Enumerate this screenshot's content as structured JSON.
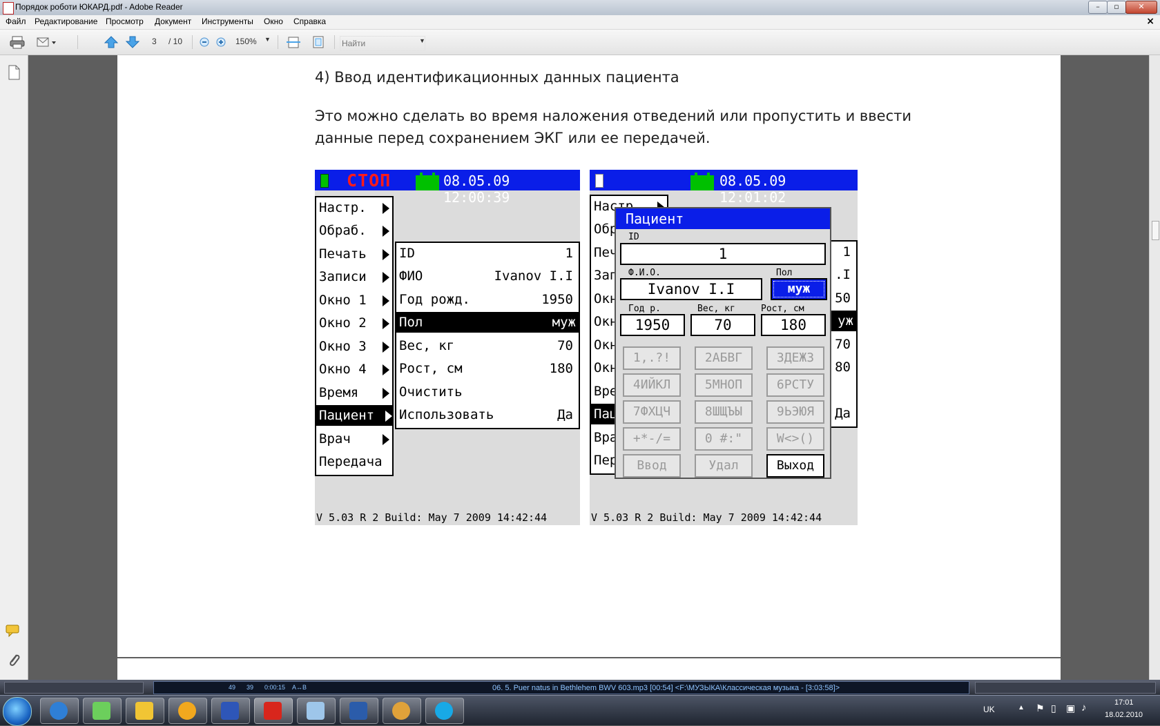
{
  "window": {
    "title": "Порядок роботи ЮКАРД.pdf - Adobe Reader"
  },
  "menu": [
    "Файл",
    "Редактирование",
    "Просмотр",
    "Документ",
    "Инструменты",
    "Окно",
    "Справка"
  ],
  "toolbar": {
    "page_current": "3",
    "page_total": "/ 10",
    "zoom": "150%",
    "find_placeholder": "Найти"
  },
  "doc": {
    "heading": "4)   Ввод идентификационных данных пациента",
    "para1": "Это можно сделать во время наложения отведений или пропустить и ввести",
    "para2": "данные перед сохранением ЭКГ или ее передачей."
  },
  "screen1": {
    "status": "СТОП",
    "datetime": "08.05.09  12:00:39",
    "menu": [
      "Настр.",
      "Обраб.",
      "Печать",
      "Записи",
      "Окно 1",
      "Окно 2",
      "Окно 3",
      "Окно 4",
      "Время",
      "Пациент",
      "Врач",
      "Передача"
    ],
    "submenu": [
      {
        "label": "ID",
        "value": "1"
      },
      {
        "label": "ФИО",
        "value": "Ivanov I.I"
      },
      {
        "label": "Год рожд.",
        "value": "1950"
      },
      {
        "label": "Пол",
        "value": "муж"
      },
      {
        "label": "Вес, кг",
        "value": "70"
      },
      {
        "label": "Рост, см",
        "value": "180"
      },
      {
        "label": "Очистить",
        "value": ""
      },
      {
        "label": "Использовать",
        "value": "Да"
      }
    ],
    "version": "V 5.03 R 2 Build: May  7 2009 14:42:44"
  },
  "screen2": {
    "datetime": "08.05.09  12:01:02",
    "bg_menu": [
      "Настр.",
      "Обр",
      "Печ",
      "Зап",
      "Окн",
      "Окн",
      "Окн",
      "Окн",
      "Вре",
      "Пац",
      "Вра",
      "Пер"
    ],
    "bg_values": [
      "1",
      ".I",
      "50",
      "уж",
      "70",
      "80",
      "",
      "Да"
    ],
    "dialog": {
      "title": "Пациент",
      "id_label": "ID",
      "id_value": "1",
      "fio_label": "Ф.И.О.",
      "fio_value": "Ivanov I.I",
      "sex_label": "Пол",
      "sex_value": "муж",
      "year_label": "Год р.",
      "year_value": "1950",
      "weight_label": "Вес, кг",
      "weight_value": "70",
      "height_label": "Рост, см",
      "height_value": "180",
      "keys": [
        "1,.?!",
        "2АБВГ",
        "3ДЕЖЗ",
        "4ИЙКЛ",
        "5МНОП",
        "6РСТУ",
        "7ФХЦЧ",
        "8ШЩЪЫ",
        "9ЬЭЮЯ",
        "+*-/=",
        "0 #:\"",
        "W<>()",
        "Ввод",
        "Удал",
        "Выход"
      ]
    },
    "version": "V 5.03 R 2 Build: May  7 2009 14:42:44"
  },
  "player": {
    "n1": "49",
    "n2": "39",
    "time": "0:00:15",
    "ab": "A↔B",
    "track": "06. 5. Puer natus in Bethlehem BWV 603.mp3  [00:54]   <F:\\МУЗЫКА\\Классическая музыка - [3:03:58]>"
  },
  "taskbar": {
    "lang": "UK",
    "time": "17:01",
    "date": "18.02.2010"
  },
  "colors": {
    "device_blue": "#0a1ee8",
    "stop_red": "#ff1a1a",
    "battery_green": "#00c000"
  }
}
